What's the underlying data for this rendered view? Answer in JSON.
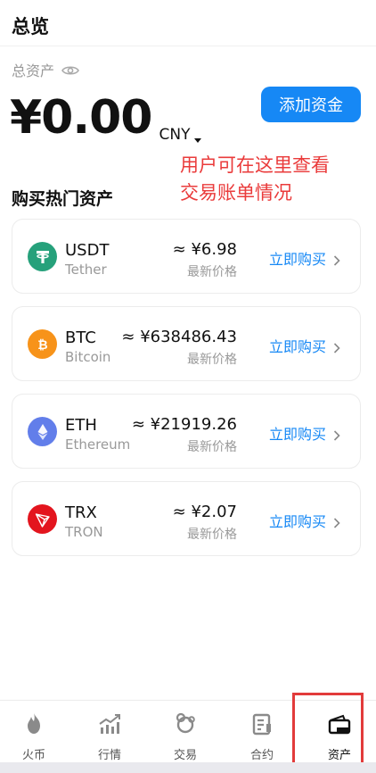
{
  "header": {
    "title": "总览"
  },
  "total_assets": {
    "label": "总资产",
    "amount": "¥0.00",
    "currency": "CNY",
    "add_funds_label": "添加资金"
  },
  "annotation": {
    "line1": "用户可在这里查看",
    "line2": "交易账单情况"
  },
  "section": {
    "title": "购买热门资产"
  },
  "assets": [
    {
      "symbol": "USDT",
      "name": "Tether",
      "price": "≈ ¥6.98",
      "price_label": "最新价格",
      "buy_label": "立即购买",
      "icon": "tether-icon",
      "color": "#26a17b"
    },
    {
      "symbol": "BTC",
      "name": "Bitcoin",
      "price": "≈ ¥638486.43",
      "price_label": "最新价格",
      "buy_label": "立即购买",
      "icon": "bitcoin-icon",
      "color": "#f7931a"
    },
    {
      "symbol": "ETH",
      "name": "Ethereum",
      "price": "≈ ¥21919.26",
      "price_label": "最新价格",
      "buy_label": "立即购买",
      "icon": "ethereum-icon",
      "color": "#627eea"
    },
    {
      "symbol": "TRX",
      "name": "TRON",
      "price": "≈ ¥2.07",
      "price_label": "最新价格",
      "buy_label": "立即购买",
      "icon": "tron-icon",
      "color": "#e3151e"
    }
  ],
  "tabs": [
    {
      "label": "火币",
      "icon": "flame-icon",
      "active": false
    },
    {
      "label": "行情",
      "icon": "chart-icon",
      "active": false
    },
    {
      "label": "交易",
      "icon": "exchange-icon",
      "active": false
    },
    {
      "label": "合约",
      "icon": "contract-icon",
      "active": false
    },
    {
      "label": "资产",
      "icon": "wallet-icon",
      "active": true
    }
  ],
  "colors": {
    "accent": "#1688f5",
    "annotation": "#ea3b3b",
    "muted": "#999999"
  }
}
